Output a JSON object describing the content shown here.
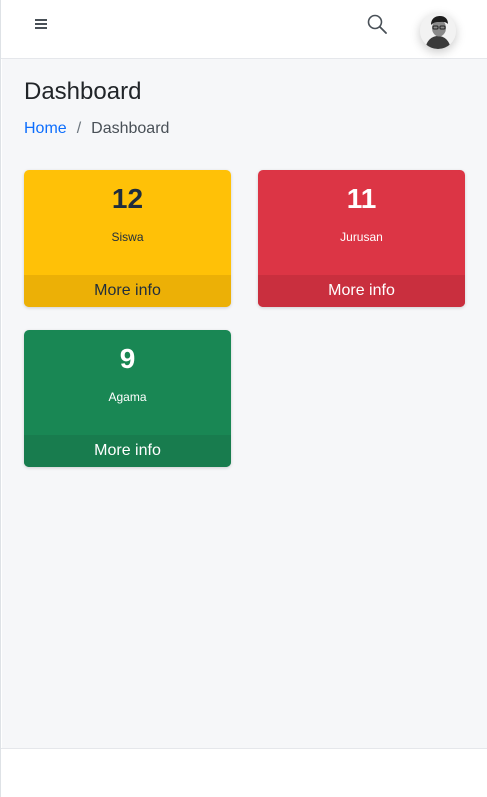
{
  "navbar": {
    "menu_icon": "hamburger-icon",
    "search_icon": "search-icon",
    "avatar_icon": "user-avatar"
  },
  "page": {
    "title": "Dashboard"
  },
  "breadcrumb": {
    "home": "Home",
    "separator": "/",
    "current": "Dashboard"
  },
  "cards": [
    {
      "count": "12",
      "label": "Siswa",
      "footer": "More info",
      "color": "#ffc107"
    },
    {
      "count": "11",
      "label": "Jurusan",
      "footer": "More info",
      "color": "#dc3545"
    },
    {
      "count": "9",
      "label": "Agama",
      "footer": "More info",
      "color": "#198754"
    }
  ]
}
